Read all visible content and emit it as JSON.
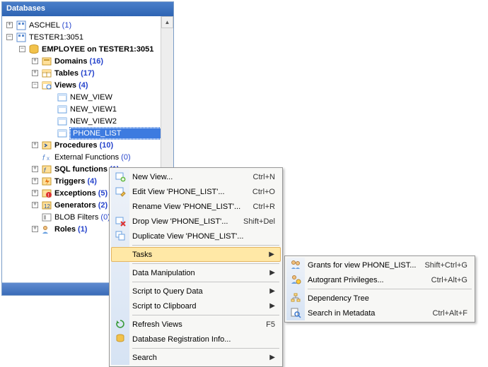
{
  "panel_title": "Databases",
  "tree": {
    "aschel": {
      "label": "ASCHEL",
      "count": "(1)"
    },
    "tester": {
      "label": "TESTER1:3051"
    },
    "employee": {
      "label": "EMPLOYEE on TESTER1:3051"
    },
    "domains": {
      "label": "Domains",
      "count": "(16)"
    },
    "tables": {
      "label": "Tables",
      "count": "(17)"
    },
    "views": {
      "label": "Views",
      "count": "(4)"
    },
    "view0": {
      "label": "NEW_VIEW"
    },
    "view1": {
      "label": "NEW_VIEW1"
    },
    "view2": {
      "label": "NEW_VIEW2"
    },
    "view3": {
      "label": "PHONE_LIST"
    },
    "procedures": {
      "label": "Procedures",
      "count": "(10)"
    },
    "extfunc": {
      "label": "External Functions",
      "count": "(0)"
    },
    "sqlfunc": {
      "label": "SQL functions",
      "count": "(1)"
    },
    "triggers": {
      "label": "Triggers",
      "count": "(4)"
    },
    "exceptions": {
      "label": "Exceptions",
      "count": "(5)"
    },
    "generators": {
      "label": "Generators",
      "count": "(2)"
    },
    "blob": {
      "label": "BLOB Filters",
      "count": "(0)"
    },
    "roles": {
      "label": "Roles",
      "count": "(1)"
    }
  },
  "menu1": {
    "new": {
      "label": "New View...",
      "shortcut": "Ctrl+N"
    },
    "edit": {
      "label": "Edit View 'PHONE_LIST'...",
      "shortcut": "Ctrl+O"
    },
    "rename": {
      "label": "Rename View 'PHONE_LIST'...",
      "shortcut": "Ctrl+R"
    },
    "drop": {
      "label": "Drop View 'PHONE_LIST'...",
      "shortcut": "Shift+Del"
    },
    "dup": {
      "label": "Duplicate View 'PHONE_LIST'..."
    },
    "tasks": {
      "label": "Tasks"
    },
    "datamanip": {
      "label": "Data Manipulation"
    },
    "script_query": {
      "label": "Script to Query Data"
    },
    "script_clip": {
      "label": "Script to Clipboard"
    },
    "refresh": {
      "label": "Refresh Views",
      "shortcut": "F5"
    },
    "dbreg": {
      "label": "Database Registration Info..."
    },
    "search": {
      "label": "Search"
    }
  },
  "menu2": {
    "grants": {
      "label": "Grants for view PHONE_LIST...",
      "shortcut": "Shift+Ctrl+G"
    },
    "autogrant": {
      "label": "Autogrant Privileges...",
      "shortcut": "Ctrl+Alt+G"
    },
    "deptree": {
      "label": "Dependency Tree"
    },
    "searchmeta": {
      "label": "Search in Metadata",
      "shortcut": "Ctrl+Alt+F"
    }
  }
}
